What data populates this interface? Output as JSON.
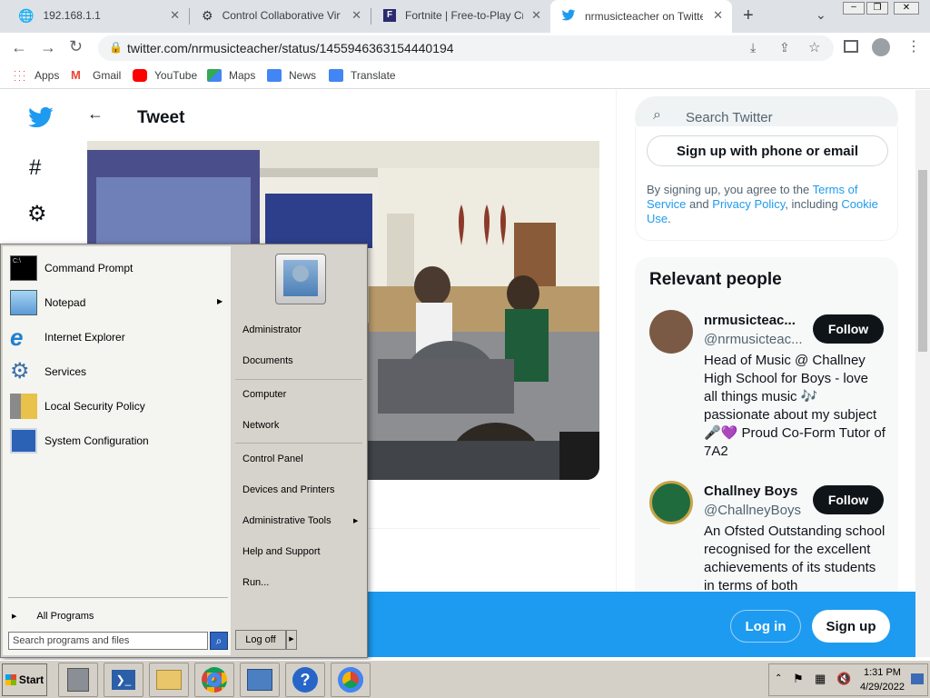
{
  "tabs": [
    {
      "title": "192.168.1.1"
    },
    {
      "title": "Control Collaborative Virtu"
    },
    {
      "title": "Fortnite | Free-to-Play Cros"
    },
    {
      "title": "nrmusicteacher on Twitter:"
    }
  ],
  "address": "twitter.com/nrmusicteacher/status/1455946363154440194",
  "bookmarks": [
    "Apps",
    "Gmail",
    "YouTube",
    "Maps",
    "News",
    "Translate"
  ],
  "tweet": {
    "title": "Tweet"
  },
  "search": {
    "placeholder": "Search Twitter"
  },
  "signup": {
    "button": "Sign up with phone or email",
    "terms_prefix": "By signing up, you agree to the ",
    "terms": "Terms of Service",
    "and": " and ",
    "privacy": "Privacy Policy",
    "including": ", including ",
    "cookie": "Cookie Use",
    "period": "."
  },
  "relevant": {
    "heading": "Relevant people",
    "people": [
      {
        "name": "nrmusicteac...",
        "handle": "@nrmusicteac...",
        "follow": "Follow",
        "bio": "Head of Music @ Challney High School for Boys - love all things music 🎶 passionate about my subject 🎤💜 Proud Co-Form Tutor of 7A2"
      },
      {
        "name": "Challney Boys",
        "handle": "@ChallneyBoys",
        "follow": "Follow",
        "bio": "An Ofsted Outstanding school recognised for the excellent achievements of its students in terms of both"
      }
    ]
  },
  "bottom_bar": {
    "login": "Log in",
    "signup": "Sign up"
  },
  "start_menu": {
    "programs": [
      "Command Prompt",
      "Notepad",
      "Internet Explorer",
      "Services",
      "Local Security Policy",
      "System Configuration"
    ],
    "all_programs": "All Programs",
    "search_placeholder": "Search programs and files",
    "right": {
      "user": "Administrator",
      "documents": "Documents",
      "computer": "Computer",
      "network": "Network",
      "control_panel": "Control Panel",
      "devices": "Devices and Printers",
      "admin_tools": "Administrative Tools",
      "help": "Help and Support",
      "run": "Run..."
    },
    "logoff": "Log off"
  },
  "taskbar": {
    "start": "Start",
    "time": "1:31 PM",
    "date": "4/29/2022"
  },
  "colors": {
    "twitter_blue": "#1d9bf0",
    "chrome_tabstrip": "#dee1e6",
    "win_gray": "#d4d0c8"
  }
}
